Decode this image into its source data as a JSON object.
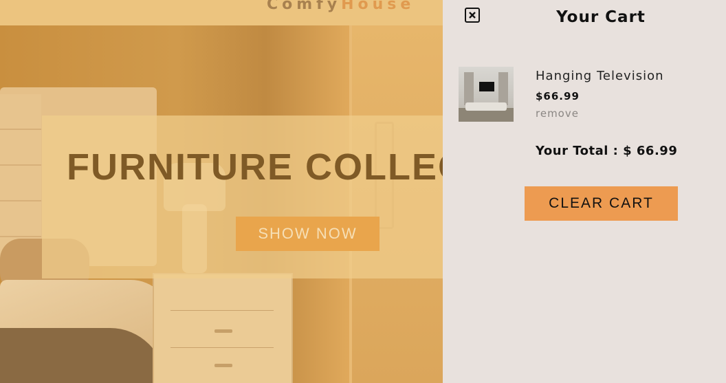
{
  "navbar": {
    "logo_part1": "Comfy",
    "logo_part2": "House"
  },
  "hero": {
    "title": "FURNITURE COLLECTION",
    "button_label": "SHOW NOW"
  },
  "cart": {
    "title": "Your Cart",
    "close_icon": "close-icon",
    "items": [
      {
        "name": "Hanging Television",
        "price": "$66.99",
        "remove_label": "remove",
        "thumbnail_icon": "product-thumbnail"
      }
    ],
    "total_label": "Your Total : $ 66.99",
    "clear_label": "CLEAR CART"
  },
  "colors": {
    "accent": "#ed9b51",
    "cart_bg": "#e8e1dd",
    "hero_overlay": "#f0cd8c",
    "title_brown": "#7f5a26"
  }
}
